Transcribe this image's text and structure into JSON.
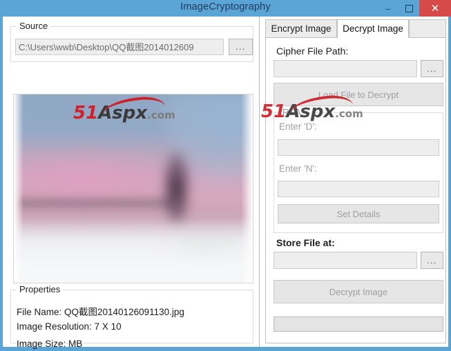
{
  "window": {
    "title": "ImageCryptography",
    "controls": {
      "minimize": "–",
      "maximize": "□",
      "close": "✕"
    },
    "accent_color": "#5ba4d6",
    "close_color": "#d64a4a"
  },
  "watermark": {
    "part1": "51",
    "part2": "Aspx",
    "part3": ".com",
    "red": "#cf1f28",
    "dark": "#3a3a3a",
    "gray": "#7a7a7a"
  },
  "left_panel": {
    "source_group": {
      "legend": "Source",
      "path_value": "C:\\Users\\wwb\\Desktop\\QQ截图2014012609",
      "browse_label": "..."
    },
    "preview": {
      "alt": "blurred photo preview"
    },
    "properties_group": {
      "legend": "Properties",
      "lines": [
        "File Name: QQ截图20140126091130.jpg",
        "Image Resolution: 7 X 10",
        "Image Size: MB"
      ]
    }
  },
  "right_panel": {
    "tabs": [
      {
        "label": "Encrypt Image",
        "active": false
      },
      {
        "label": "Decrypt Image",
        "active": true
      }
    ],
    "cipher_path": {
      "label": "Cipher File Path:",
      "value": "",
      "browse_label": "..."
    },
    "load_button": "Load File to Decrypt",
    "rsa_group": {
      "legend": "RSA:",
      "d_label": "Enter 'D':",
      "d_value": "",
      "n_label": "Enter 'N':",
      "n_value": "",
      "set_details_label": "Set Details"
    },
    "store_file": {
      "label": "Store File at:",
      "value": "",
      "browse_label": "..."
    },
    "decrypt_button": "Decrypt Image",
    "progress_value": ""
  }
}
